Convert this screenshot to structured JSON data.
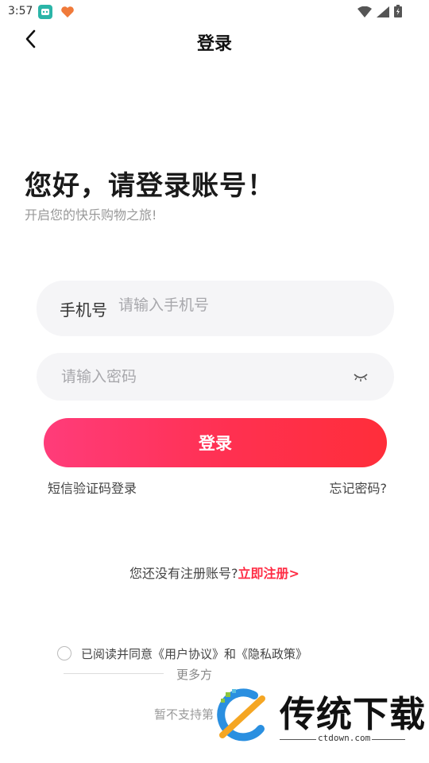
{
  "status_bar": {
    "time": "3:57"
  },
  "header": {
    "title": "登录"
  },
  "greeting": {
    "title": "您好，请登录账号！",
    "subtitle": "开启您的快乐购物之旅!"
  },
  "phone_field": {
    "label": "手机号",
    "placeholder": "请输入手机号",
    "value": ""
  },
  "password_field": {
    "placeholder": "请输入密码",
    "value": ""
  },
  "login_button": {
    "label": "登录"
  },
  "links": {
    "sms_login": "短信验证码登录",
    "forgot_password": "忘记密码?"
  },
  "register": {
    "prompt": "您还没有注册账号?",
    "link": "立即注册>"
  },
  "agreement": {
    "prefix": "已阅读并同意",
    "user_agreement": "《用户协议》",
    "conjunction": "和",
    "privacy_policy": "《隐私政策》",
    "checked": false
  },
  "other_login": {
    "more": "更多方",
    "unsupported": "暂不支持第"
  },
  "watermark": {
    "title": "传统下载",
    "url": "ctdown.com"
  },
  "colors": {
    "accent": "#ff2d45",
    "button_gradient_start": "#ff3c7a",
    "button_gradient_end": "#ff2e3a",
    "input_bg": "#f5f5f7"
  },
  "icons": [
    "back-arrow-icon",
    "eye-closed-icon",
    "wifi-icon",
    "signal-icon",
    "battery-icon"
  ]
}
